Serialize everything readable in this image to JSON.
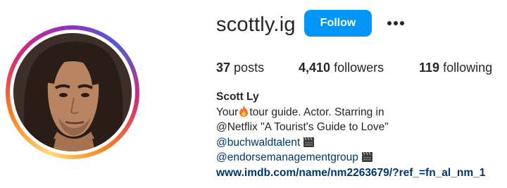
{
  "profile": {
    "username": "scottly.ig",
    "follow_label": "Follow",
    "more_icon": "more-horizontal-icon",
    "avatar_ring_colors": [
      "#feda75",
      "#fa7e1e",
      "#d62976",
      "#962fbf",
      "#4f5bd5"
    ]
  },
  "stats": {
    "posts_count": "37",
    "posts_label": "posts",
    "followers_count": "4,410",
    "followers_label": "followers",
    "following_count": "119",
    "following_label": "following"
  },
  "bio": {
    "name": "Scott Ly",
    "line1_prefix": "Your",
    "line1_icon": "fire-emoji-icon",
    "line1_suffix": "tour guide. Actor. Starring in",
    "line2": "@Netflix \"A Tourist's Guide to Love\"",
    "tag1": "@buchwaldtalent",
    "tag2": "@endorsemanagementgroup",
    "tag_icon": "clapperboard-emoji-icon",
    "link": "www.imdb.com/name/nm2263679/?ref_=fn_al_nm_1"
  },
  "colors": {
    "follow_button": "#0095f6",
    "link": "#00376b",
    "text": "#262626"
  }
}
